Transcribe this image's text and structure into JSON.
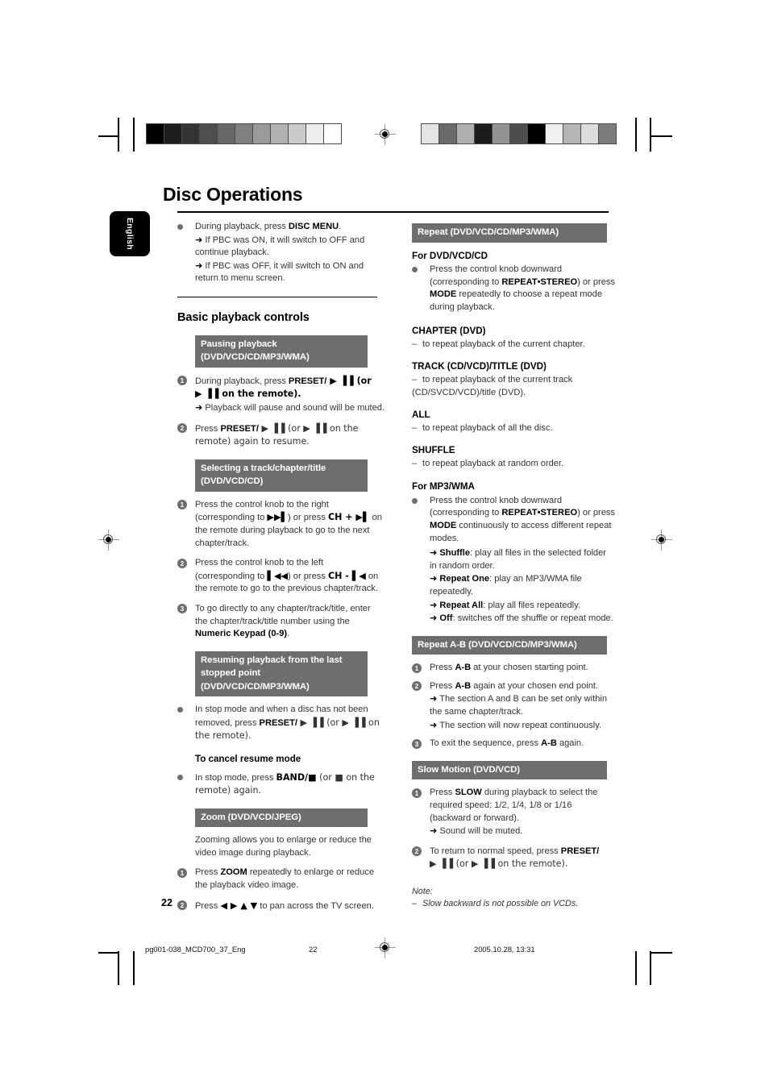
{
  "page": {
    "title": "Disc Operations",
    "language_tab": "English",
    "page_number": "22"
  },
  "footer": {
    "filename": "pg001-038_MCD700_37_Eng",
    "page": "22",
    "timestamp": "2005.10.28, 13:31"
  },
  "calibration": {
    "left_swatches": [
      "#000000",
      "#1e1e1e",
      "#343434",
      "#4e4e4e",
      "#676767",
      "#7f7f7f",
      "#9a9a9a",
      "#b2b2b2",
      "#cbcbcb",
      "#ededed",
      "#ffffff"
    ],
    "right_swatches": [
      "#e4e4e4",
      "#6a6a6a",
      "#b0b0b0",
      "#1c1c1c",
      "#939393",
      "#4d4d4d",
      "#000000",
      "#f0f0f0",
      "#b5b5b5",
      "#dcdcdc",
      "#7c7c7c"
    ]
  },
  "left_column": {
    "intro": {
      "line1_a": "During playback, press ",
      "line1_b": "DISC MENU",
      "line1_c": ".",
      "arrow1": "If PBC was ON, it will switch to OFF and continue playback.",
      "arrow2": "If PBC was OFF, it will switch to ON and return to menu screen."
    },
    "heading_basic": "Basic playback controls",
    "pausing": {
      "banner": "Pausing playback (DVD/VCD/CD/MP3/WMA)",
      "step1_a": "During playback, press ",
      "step1_b": "PRESET/",
      "step1_c": " ▶ ▐▐ (or",
      "step1_d": "▶ ▐▐ on the remote).",
      "step1_arrow": "Playback will pause and sound will be muted.",
      "step2_a": "Press ",
      "step2_b": "PRESET/",
      "step2_c": " ▶ ▐▐ (or  ▶ ▐▐ on the remote) again to resume."
    },
    "selecting": {
      "banner": "Selecting a track/chapter/title (DVD/VCD/CD)",
      "step1_a": "Press the control knob to the right (corresponding to ",
      "step1_b": "▶▶▌",
      "step1_c": ") or press ",
      "step1_d": "CH + ▶▌",
      "step1_e": " on the remote during playback to go to the next chapter/track.",
      "step2_a": "Press the control knob to the left (corresponding to ",
      "step2_b": "▌◀◀",
      "step2_c": ") or press ",
      "step2_d": "CH - ▌◀",
      "step2_e": " on the remote to go to the previous chapter/track.",
      "step3_a": "To go directly to any chapter/track/title, enter the chapter/track/title number using the ",
      "step3_b": "Numeric Keypad (0-9)",
      "step3_c": "."
    },
    "resuming": {
      "banner": "Resuming playback from the last stopped point (DVD/VCD/CD/MP3/WMA)",
      "bullet_a": "In stop mode and when a disc has not been removed, press ",
      "bullet_b": "PRESET/",
      "bullet_c": " ▶ ▐▐ (or  ▶ ▐▐ on the remote).",
      "cancel_heading": "To cancel resume mode",
      "cancel_a": "In stop mode, press ",
      "cancel_b": "BAND/■",
      "cancel_c": " (or ■ on the remote) again."
    },
    "zoom": {
      "banner": "Zoom (DVD/VCD/JPEG)",
      "intro": "Zooming allows you to enlarge or reduce the video image during playback.",
      "step1_a": "Press ",
      "step1_b": "ZOOM",
      "step1_c": " repeatedly to enlarge or reduce the playback video image.",
      "step2_a": "Press ",
      "step2_b": "◀ ▶ ▲ ▼",
      "step2_c": " to pan across the TV screen."
    }
  },
  "right_column": {
    "repeat": {
      "banner": "Repeat (DVD/VCD/CD/MP3/WMA)",
      "for_dvd_heading": "For DVD/VCD/CD",
      "for_dvd_a": "Press the control knob downward (corresponding to ",
      "for_dvd_b": "REPEAT•STEREO",
      "for_dvd_c": ") or press ",
      "for_dvd_d": "MODE",
      "for_dvd_e": " repeatedly to choose a repeat mode during playback.",
      "modes": [
        {
          "name": "CHAPTER (DVD)",
          "desc": "to repeat playback of the current chapter."
        },
        {
          "name": "TRACK (CD/VCD)/TITLE (DVD)",
          "desc": "to repeat playback of the current track (CD/SVCD/VCD)/title (DVD)."
        },
        {
          "name": "ALL",
          "desc": "to repeat playback of all the disc."
        },
        {
          "name": "SHUFFLE",
          "desc": "to repeat playback at random order."
        }
      ],
      "for_mp3_heading": "For MP3/WMA",
      "for_mp3_a": "Press the control knob downward (corresponding to ",
      "for_mp3_b": "REPEAT•STEREO",
      "for_mp3_c": ") or press ",
      "for_mp3_d": "MODE",
      "for_mp3_e": " continuously to access different repeat modes.",
      "mp3_modes": [
        {
          "name": "Shuffle",
          "desc": ": play all files in the selected folder in random order."
        },
        {
          "name": "Repeat One",
          "desc": ": play an MP3/WMA file repeatedly."
        },
        {
          "name": "Repeat All",
          "desc": ": play all files repeatedly."
        },
        {
          "name": "Off",
          "desc": ": switches off the shuffle or repeat mode."
        }
      ]
    },
    "repeat_ab": {
      "banner": "Repeat A-B (DVD/VCD/CD/MP3/WMA)",
      "step1_a": "Press ",
      "step1_b": "A-B",
      "step1_c": " at your chosen starting point.",
      "step2_a": "Press ",
      "step2_b": "A-B",
      "step2_c": " again at your chosen end point.",
      "step2_arrow1": "The section A and B can be set only within the same chapter/track.",
      "step2_arrow2": "The section will now repeat continuously.",
      "step3_a": "To exit the sequence, press ",
      "step3_b": "A-B",
      "step3_c": " again."
    },
    "slow_motion": {
      "banner": "Slow Motion (DVD/VCD)",
      "step1_a": "Press ",
      "step1_b": "SLOW",
      "step1_c": " during playback to select the required speed: 1/2, 1/4, 1/8 or 1/16 (backward or forward).",
      "step1_arrow": "Sound will be muted.",
      "step2_a": "To return to normal speed, press ",
      "step2_b": "PRESET/",
      "step2_c": "▶ ▐▐ (or ▶ ▐▐ on the remote).",
      "note_label": "Note:",
      "note_text": "Slow backward is not possible on VCDs."
    }
  },
  "icons": {
    "bullet": "bullet-dot",
    "arrow": "➔",
    "dash": "–",
    "numbers": [
      "①",
      "②",
      "③"
    ]
  },
  "colors": {
    "banner_bg": "#6e6e6e",
    "banner_text": "#ffffff",
    "body_text": "#333333",
    "bold_text": "#000000",
    "tab_bg": "#000000"
  }
}
